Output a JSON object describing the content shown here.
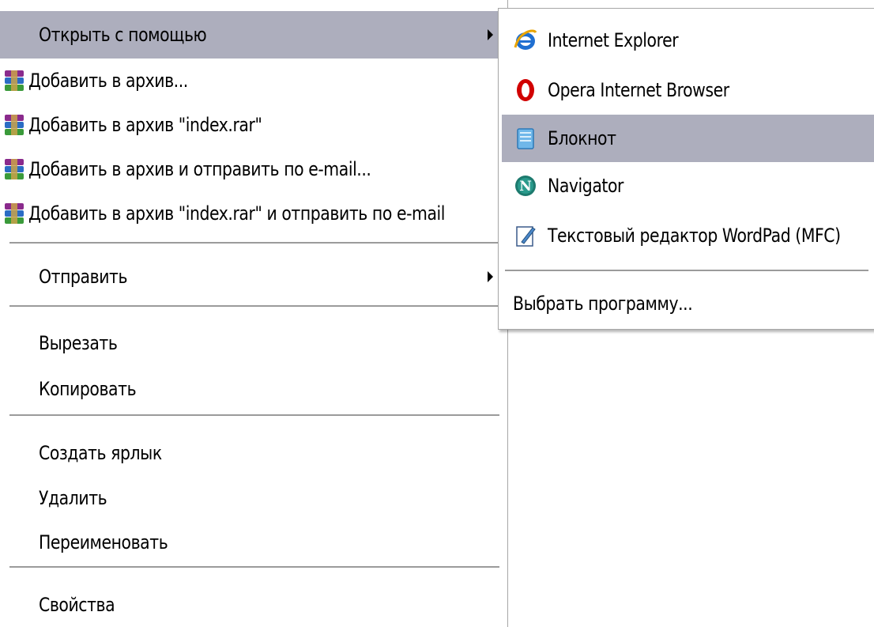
{
  "main_menu": {
    "items": [
      {
        "label": "Открыть с помощью",
        "has_submenu": true,
        "highlighted": true
      },
      {
        "label": "Добавить в архив...",
        "icon": "winrar-icon"
      },
      {
        "label": "Добавить в архив \"index.rar\"",
        "icon": "winrar-icon"
      },
      {
        "label": "Добавить в архив и отправить по e-mail...",
        "icon": "winrar-icon"
      },
      {
        "label": "Добавить в архив \"index.rar\" и отправить по e-mail",
        "icon": "winrar-icon"
      },
      {
        "label": "Отправить",
        "has_submenu": true
      },
      {
        "label": "Вырезать"
      },
      {
        "label": "Копировать"
      },
      {
        "label": "Создать ярлык"
      },
      {
        "label": "Удалить"
      },
      {
        "label": "Переименовать"
      },
      {
        "label": "Свойства"
      }
    ]
  },
  "open_with_submenu": {
    "items": [
      {
        "label": "Internet Explorer",
        "icon": "internet-explorer-icon"
      },
      {
        "label": "Opera Internet Browser",
        "icon": "opera-icon"
      },
      {
        "label": "Блокнот",
        "icon": "notepad-icon",
        "highlighted": true
      },
      {
        "label": "Navigator",
        "icon": "netscape-navigator-icon"
      },
      {
        "label": "Текстовый редактор WordPad (MFC)",
        "icon": "wordpad-icon"
      },
      {
        "label": "Выбрать программу..."
      }
    ]
  },
  "colors": {
    "highlight": "#adaebd",
    "separator": "#9b9b9b",
    "background": "#ffffff"
  }
}
